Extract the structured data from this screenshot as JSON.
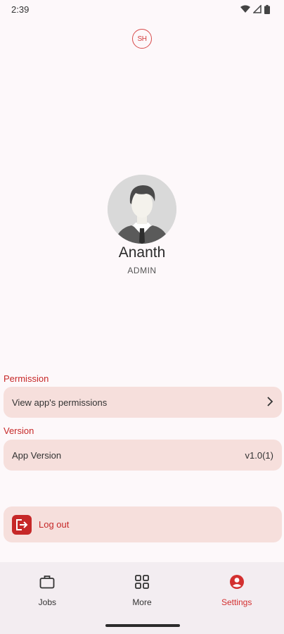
{
  "status_bar": {
    "time": "2:39"
  },
  "logo": {
    "text": "SH"
  },
  "profile": {
    "name": "Ananth",
    "role": "ADMIN"
  },
  "permission": {
    "section_title": "Permission",
    "item_label": "View app's permissions"
  },
  "version": {
    "section_title": "Version",
    "item_label": "App Version",
    "item_value": "v1.0(1)"
  },
  "logout": {
    "label": "Log out"
  },
  "bottom_nav": {
    "items": [
      {
        "label": "Jobs",
        "icon": "briefcase-icon",
        "active": false
      },
      {
        "label": "More",
        "icon": "grid-icon",
        "active": false
      },
      {
        "label": "Settings",
        "icon": "account-circle-icon",
        "active": true
      }
    ]
  },
  "colors": {
    "accent": "#c62828",
    "card_bg": "#f6dfdc",
    "nav_bg": "#f3edf1",
    "page_bg": "#fdf8fa"
  }
}
